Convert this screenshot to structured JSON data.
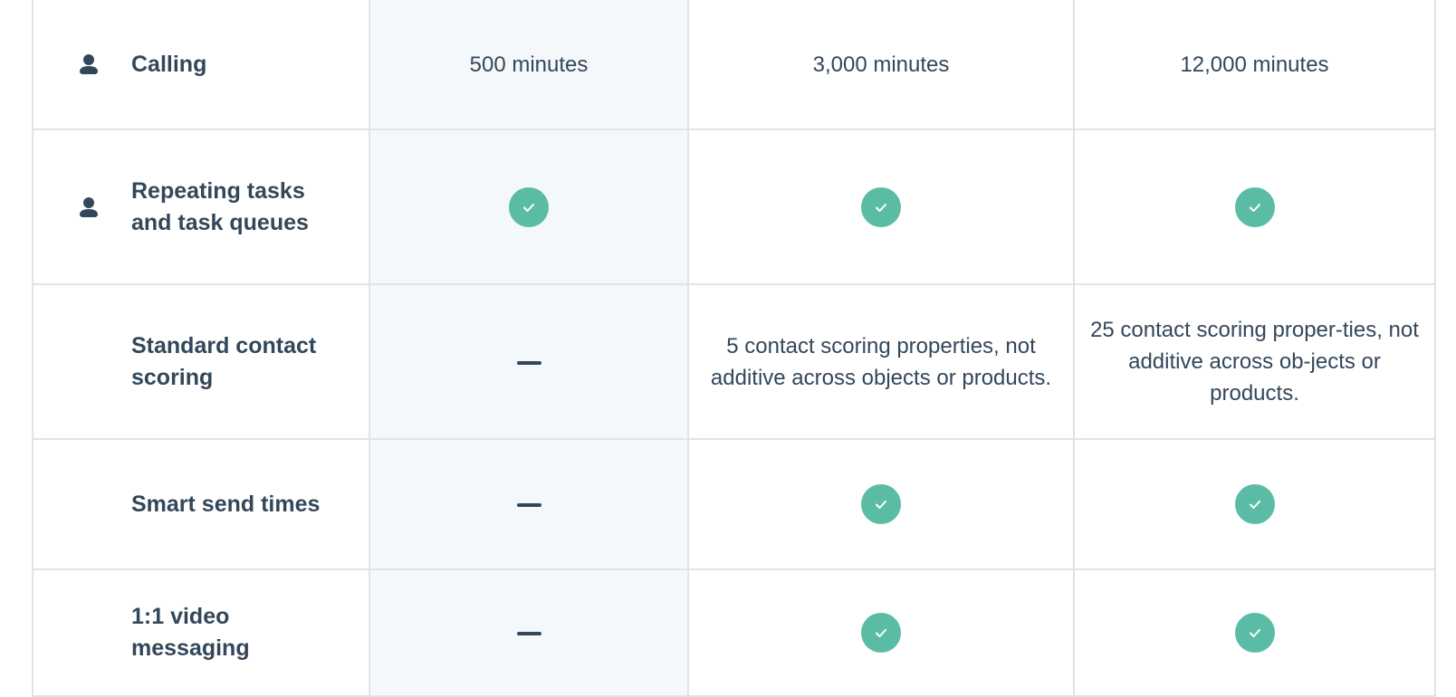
{
  "rows": [
    {
      "feature": "Calling",
      "icon": "person-icon",
      "values": [
        {
          "type": "text",
          "text": "500 minutes"
        },
        {
          "type": "text",
          "text": "3,000 minutes"
        },
        {
          "type": "text",
          "text": "12,000 minutes"
        }
      ]
    },
    {
      "feature": "Repeating tasks and task queues",
      "icon": "person-icon",
      "values": [
        {
          "type": "check"
        },
        {
          "type": "check"
        },
        {
          "type": "check"
        }
      ]
    },
    {
      "feature": "Standard contact scoring",
      "values": [
        {
          "type": "dash"
        },
        {
          "type": "text",
          "text": "5 contact scoring properties, not additive across objects or products."
        },
        {
          "type": "text",
          "text": "25 contact scoring proper-ties, not additive across ob-jects or products."
        }
      ]
    },
    {
      "feature": "Smart send times",
      "values": [
        {
          "type": "dash"
        },
        {
          "type": "check"
        },
        {
          "type": "check"
        }
      ]
    },
    {
      "feature": "1:1 video messaging",
      "values": [
        {
          "type": "dash"
        },
        {
          "type": "check"
        },
        {
          "type": "check"
        }
      ]
    }
  ],
  "colors": {
    "check": "#5bbca6",
    "text": "#33475b",
    "highlight_column": "#f5f8fa",
    "border": "#dfe3eb"
  }
}
